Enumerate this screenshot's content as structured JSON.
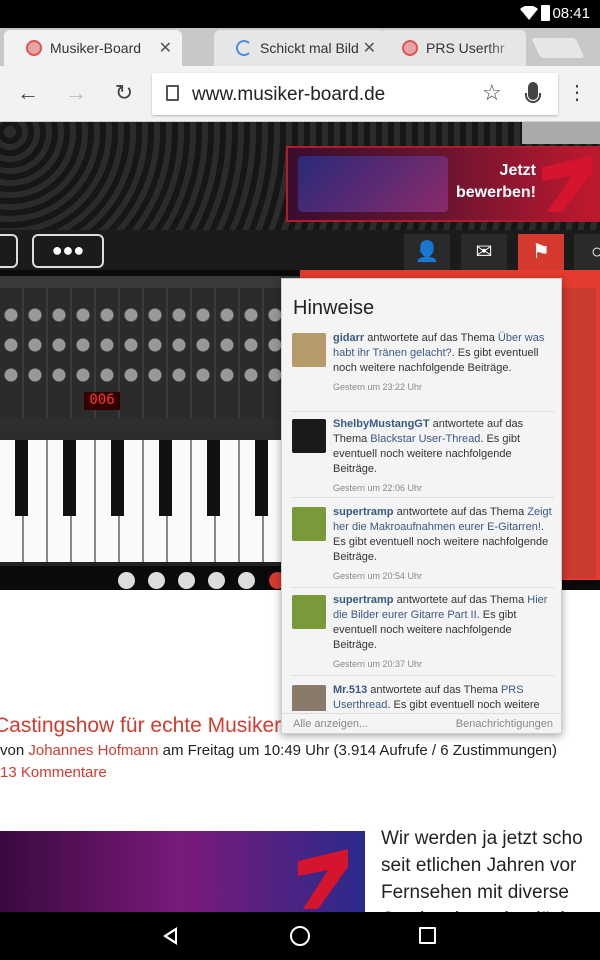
{
  "status": {
    "time": "08:41"
  },
  "tabs": [
    {
      "title": "Musiker-Board",
      "close": "✕"
    },
    {
      "title": "Schickt mal Bild",
      "close": "✕"
    },
    {
      "title": "PRS Userthr",
      "close": ""
    }
  ],
  "address": {
    "url": "www.musiker-board.de"
  },
  "ad": {
    "text": "Jetzt\nbewerben!"
  },
  "popover": {
    "title": "Hinweise",
    "notifications": [
      {
        "user": "gidarr",
        "pre": " antwortete auf das Thema ",
        "thread": "Über was habt ihr Tränen gelacht?",
        "post": ". Es gibt eventuell noch weitere nachfolgende Beiträge.",
        "time": "Gestern um 23:22 Uhr",
        "avatar": "#b79a6b"
      },
      {
        "user": "ShelbyMustangGT",
        "pre": " antwortete auf das Thema ",
        "thread": "Blackstar User-Thread",
        "post": ". Es gibt eventuell noch weitere nachfolgende Beiträge.",
        "time": "Gestern um 22:06 Uhr",
        "avatar": "#1a1a1a"
      },
      {
        "user": "supertramp",
        "pre": " antwortete auf das Thema ",
        "thread": "Zeigt her die Makroaufnahmen eurer E-Gitarren!",
        "post": ". Es gibt eventuell noch weitere nachfolgende Beiträge.",
        "time": "Gestern um 20:54 Uhr",
        "avatar": "#7a9a3a"
      },
      {
        "user": "supertramp",
        "pre": " antwortete auf das Thema ",
        "thread": "Hier die Bilder eurer Gitarre Part II",
        "post": ". Es gibt eventuell noch weitere nachfolgende Beiträge.",
        "time": "Gestern um 20:37 Uhr",
        "avatar": "#7a9a3a"
      },
      {
        "user": "Mr.513",
        "pre": " antwortete auf das Thema ",
        "thread": "PRS Userthread",
        "post": ". Es gibt eventuell noch weitere nachfolgende Beiträge.",
        "time": "",
        "avatar": "#8a7a6a"
      }
    ],
    "footer_left": "Alle anzeigen...",
    "footer_right": "Benachrichtigungen"
  },
  "article": {
    "title": "Castingshow für echte Musiker",
    "meta_prefix": "von ",
    "author": "Johannes Hofmann",
    "meta_suffix": " am Freitag um 10:49 Uhr (3.914 Aufrufe / 6 Zustimmungen)",
    "comments": "13 Kommentare",
    "text": "Wir werden ja jetzt scho\nseit etlichen Jahren vor\nFernsehen mit diverse\nCastingshows beglück"
  },
  "synth": {
    "display": "006"
  }
}
